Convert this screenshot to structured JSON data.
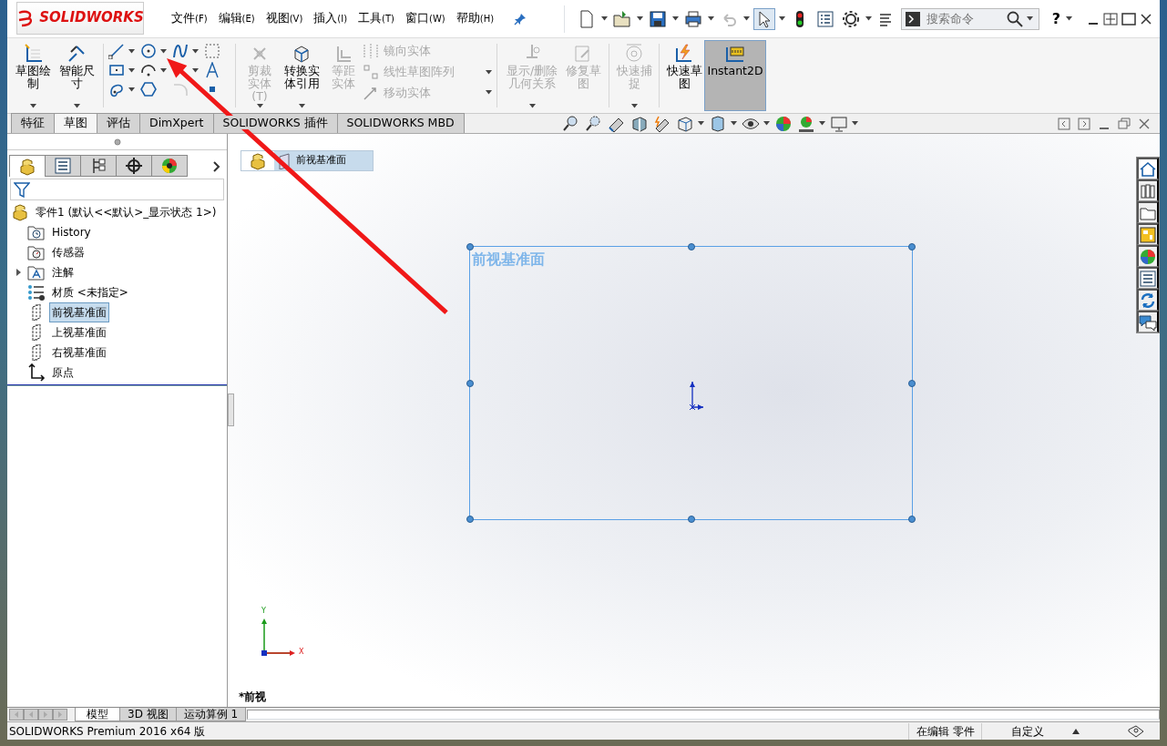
{
  "window": {
    "logo": "SOLIDWORKS"
  },
  "menu": [
    {
      "label": "文件",
      "key": "(F)"
    },
    {
      "label": "编辑",
      "key": "(E)"
    },
    {
      "label": "视图",
      "key": "(V)"
    },
    {
      "label": "插入",
      "key": "(I)"
    },
    {
      "label": "工具",
      "key": "(T)"
    },
    {
      "label": "窗口",
      "key": "(W)"
    },
    {
      "label": "帮助",
      "key": "(H)"
    }
  ],
  "search": {
    "placeholder": "搜索命令"
  },
  "help": {
    "label": "?"
  },
  "ribbon": [
    {
      "kind": "large",
      "label": "草图绘制",
      "disabled": false,
      "pressed": false,
      "dropdown": true
    },
    {
      "kind": "large",
      "label": "智能尺寸",
      "disabled": false,
      "pressed": false,
      "dropdown": true
    },
    {
      "kind": "tools"
    },
    {
      "kind": "large",
      "label": "剪裁实体(T)",
      "disabled": true,
      "pressed": false,
      "dropdown": true
    },
    {
      "kind": "large",
      "label": "转换实体引用",
      "disabled": false,
      "pressed": false,
      "dropdown": true
    },
    {
      "kind": "large",
      "label": "等距实体",
      "disabled": true,
      "pressed": false,
      "dropdown": false
    },
    {
      "kind": "stack",
      "rows": [
        {
          "label": "镜向实体",
          "disabled": true,
          "dropdown": false
        },
        {
          "label": "线性草图阵列",
          "disabled": true,
          "dropdown": true
        },
        {
          "label": "移动实体",
          "disabled": true,
          "dropdown": true
        }
      ]
    },
    {
      "kind": "large",
      "label": "显示/删除几何关系",
      "disabled": true,
      "pressed": false,
      "dropdown": true
    },
    {
      "kind": "large",
      "label": "修复草图",
      "disabled": true,
      "pressed": false,
      "dropdown": false
    },
    {
      "kind": "large",
      "label": "快速捕捉",
      "disabled": true,
      "pressed": false,
      "dropdown": true
    },
    {
      "kind": "large",
      "label": "快速草图",
      "disabled": false,
      "pressed": false,
      "dropdown": false
    },
    {
      "kind": "large",
      "label": "Instant2D",
      "disabled": false,
      "pressed": true,
      "dropdown": false
    }
  ],
  "command_tabs": [
    {
      "label": "特征",
      "selected": false
    },
    {
      "label": "草图",
      "selected": true
    },
    {
      "label": "评估",
      "selected": false
    },
    {
      "label": "DimXpert",
      "selected": false
    },
    {
      "label": "SOLIDWORKS 插件",
      "selected": false
    },
    {
      "label": "SOLIDWORKS MBD",
      "selected": false
    }
  ],
  "panel_tabs": [
    {
      "selected": true
    },
    {
      "selected": false
    },
    {
      "selected": false
    },
    {
      "selected": false
    },
    {
      "selected": false
    }
  ],
  "tree": {
    "label": "零件1  (默认<<默认>_显示状态 1>)",
    "children": [
      {
        "kind": "history",
        "label": "History",
        "selected": false
      },
      {
        "kind": "sensor",
        "label": "传感器",
        "selected": false
      },
      {
        "kind": "annotation",
        "label": "注解",
        "selected": false,
        "expanded": false
      },
      {
        "kind": "material",
        "label": "材质 <未指定>",
        "selected": false
      },
      {
        "kind": "plane",
        "label": "前视基准面",
        "selected": true
      },
      {
        "kind": "plane",
        "label": "上视基准面",
        "selected": false
      },
      {
        "kind": "plane",
        "label": "右视基准面",
        "selected": false
      },
      {
        "kind": "origin",
        "label": "原点",
        "selected": false
      }
    ]
  },
  "task_pane": [
    {
      "selected": true
    },
    {
      "selected": false
    },
    {
      "selected": false
    },
    {
      "selected": false
    },
    {
      "selected": false
    },
    {
      "selected": false
    },
    {
      "selected": false
    },
    {
      "selected": false
    }
  ],
  "breadcrumb": {
    "label": "前视基准面"
  },
  "plane": {
    "label": "前视基准面"
  },
  "triad": {
    "x": "X",
    "y": "Y"
  },
  "view_label": "*前视",
  "model_tabs": [
    {
      "label": "模型",
      "selected": true
    },
    {
      "label": "3D 视图",
      "selected": false
    },
    {
      "label": "运动算例 1",
      "selected": false
    }
  ],
  "status_bar": {
    "product": "SOLIDWORKS Premium 2016 x64 版",
    "mode": "在编辑 零件",
    "units": "自定义"
  }
}
